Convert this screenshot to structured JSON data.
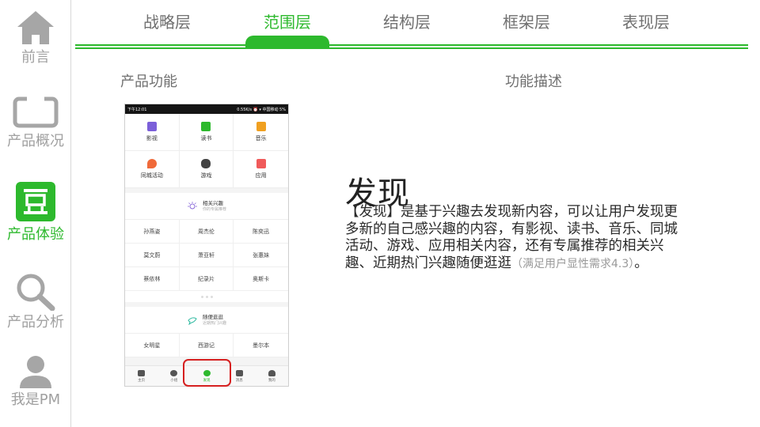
{
  "sidebar": {
    "items": [
      {
        "label": "前言",
        "icon": "home-icon"
      },
      {
        "label": "产品概况",
        "icon": "monitor-icon"
      },
      {
        "label": "产品体验",
        "icon": "douban-logo-icon",
        "active": true
      },
      {
        "label": "产品分析",
        "icon": "magnifier-icon"
      },
      {
        "label": "我是PM",
        "icon": "person-icon"
      }
    ]
  },
  "tabs": [
    {
      "label": "战略层"
    },
    {
      "label": "范围层",
      "active": true
    },
    {
      "label": "结构层"
    },
    {
      "label": "框架层"
    },
    {
      "label": "表现层"
    }
  ],
  "columns": {
    "left": "产品功能",
    "right": "功能描述"
  },
  "phone": {
    "status_time": "下午12:01",
    "status_right": "0.55K/s ⏰ ▾ 中国移动 5%",
    "grid": [
      {
        "label": "影视",
        "icon": "film-icon",
        "color": "#7b5fd9"
      },
      {
        "label": "读书",
        "icon": "book-icon",
        "color": "#2db92d"
      },
      {
        "label": "音乐",
        "icon": "music-note-icon",
        "color": "#f0a020"
      },
      {
        "label": "同城活动",
        "icon": "location-pin-icon",
        "color": "#f06a3a"
      },
      {
        "label": "游戏",
        "icon": "gamepad-icon",
        "color": "#444444"
      },
      {
        "label": "应用",
        "icon": "app-icon",
        "color": "#f05a5a"
      }
    ],
    "interest_card": {
      "title": "相关兴趣",
      "subtitle": "你的专属推荐",
      "tags": [
        "孙燕姿",
        "周杰伦",
        "陈奕迅",
        "莫文蔚",
        "萧亚轩",
        "张惠妹",
        "蔡依林",
        "纪录片",
        "奥斯卡"
      ]
    },
    "random_card": {
      "title": "随便逛逛",
      "subtitle": "近期热门兴趣",
      "tags": [
        "女明星",
        "西游记",
        "墨尔本"
      ]
    },
    "nav": [
      {
        "label": "主页",
        "icon": "home-icon"
      },
      {
        "label": "小组",
        "icon": "group-icon"
      },
      {
        "label": "发现",
        "icon": "discover-icon",
        "active": true
      },
      {
        "label": "消息",
        "icon": "chat-icon"
      },
      {
        "label": "我的",
        "icon": "person-icon"
      }
    ]
  },
  "description": {
    "title": "发现",
    "body": "【发现】是基于兴趣去发现新内容，可以让用户发现更多新的自己感兴趣的内容，有影视、读书、音乐、同城活动、游戏、应用相关内容，还有专属推荐的相关兴趣、近期热门兴趣随便逛逛",
    "note": "（满足用户显性需求4.3）",
    "end": "。"
  },
  "colors": {
    "accent": "#2db92d",
    "highlight": "#d62020"
  }
}
